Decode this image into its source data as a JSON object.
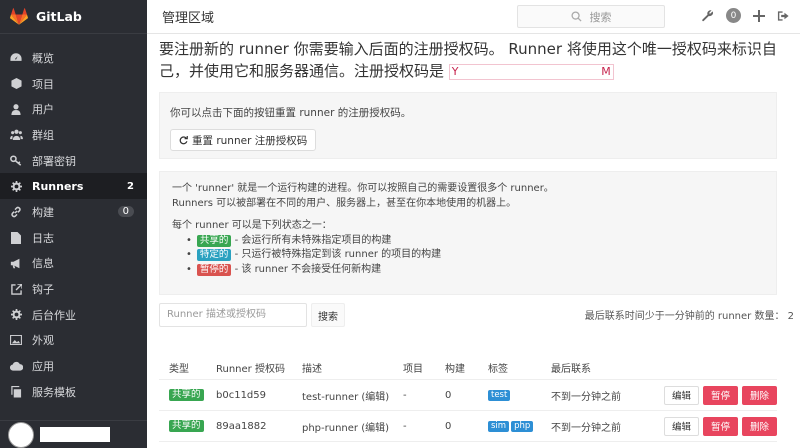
{
  "brand": {
    "name": "GitLab"
  },
  "sidebar": {
    "items": [
      {
        "label": "概览",
        "icon": "dashboard-icon"
      },
      {
        "label": "项目",
        "icon": "cube-icon"
      },
      {
        "label": "用户",
        "icon": "user-icon"
      },
      {
        "label": "群组",
        "icon": "group-icon"
      },
      {
        "label": "部署密钥",
        "icon": "key-icon"
      },
      {
        "label": "Runners",
        "icon": "cog-icon",
        "badge": "2",
        "active": true
      },
      {
        "label": "构建",
        "icon": "link-icon",
        "badge": "0"
      },
      {
        "label": "日志",
        "icon": "file-icon"
      },
      {
        "label": "信息",
        "icon": "bullhorn-icon"
      },
      {
        "label": "钩子",
        "icon": "external-link-icon"
      },
      {
        "label": "后台作业",
        "icon": "cog-icon"
      },
      {
        "label": "外观",
        "icon": "image-icon"
      },
      {
        "label": "应用",
        "icon": "cloud-icon"
      },
      {
        "label": "服务模板",
        "icon": "copy-icon"
      }
    ]
  },
  "header": {
    "title": "管理区域",
    "search_placeholder": "搜索",
    "todo_count": "0"
  },
  "intro": {
    "text": "要注册新的 runner 你需要输入后面的注册授权码。 Runner 将使用这个唯一授权码来标识自己，并使用它和服务器通信。注册授权码是",
    "token_start": "Y",
    "token_end": "M"
  },
  "reset": {
    "hint": "你可以点击下面的按钮重置 runner 的注册授权码。",
    "button": "重置 runner 注册授权码"
  },
  "info": {
    "line1": "一个 'runner' 就是一个运行构建的进程。你可以按照自己的需要设置很多个 runner。",
    "line2": "Runners 可以被部署在不同的用户、服务器上，甚至在你本地使用的机器上。",
    "states_title": "每个 runner 可以是下列状态之一：",
    "states": [
      {
        "label": "共享的",
        "desc": " - 会运行所有未特殊指定项目的构建",
        "color": "#38a651"
      },
      {
        "label": "特定的",
        "desc": " - 只运行被特殊指定到该 runner 的项目的构建",
        "color": "#2aa1c0"
      },
      {
        "label": "暂停的",
        "desc": " - 该 runner 不会接受任何新构建",
        "color": "#d9534f"
      }
    ]
  },
  "filter": {
    "placeholder": "Runner 描述或授权码",
    "search_button": "搜索",
    "online_count": "最后联系时间少于一分钟前的 runner 数量： 2"
  },
  "table": {
    "headers": [
      "类型",
      "Runner 授权码",
      "描述",
      "项目",
      "构建",
      "标签",
      "最后联系"
    ],
    "rows": [
      {
        "type": "共享的",
        "token": "b0c11d59",
        "desc": "test-runner (编辑)",
        "projects": "-",
        "builds": "0",
        "tags": [
          "test"
        ],
        "last": "不到一分钟之前"
      },
      {
        "type": "共享的",
        "token": "89aa1882",
        "desc": "php-runner (编辑)",
        "projects": "-",
        "builds": "0",
        "tags": [
          "sim",
          "php"
        ],
        "last": "不到一分钟之前"
      }
    ],
    "actions": {
      "edit": "编辑",
      "pause": "暂停",
      "delete": "删除"
    }
  }
}
